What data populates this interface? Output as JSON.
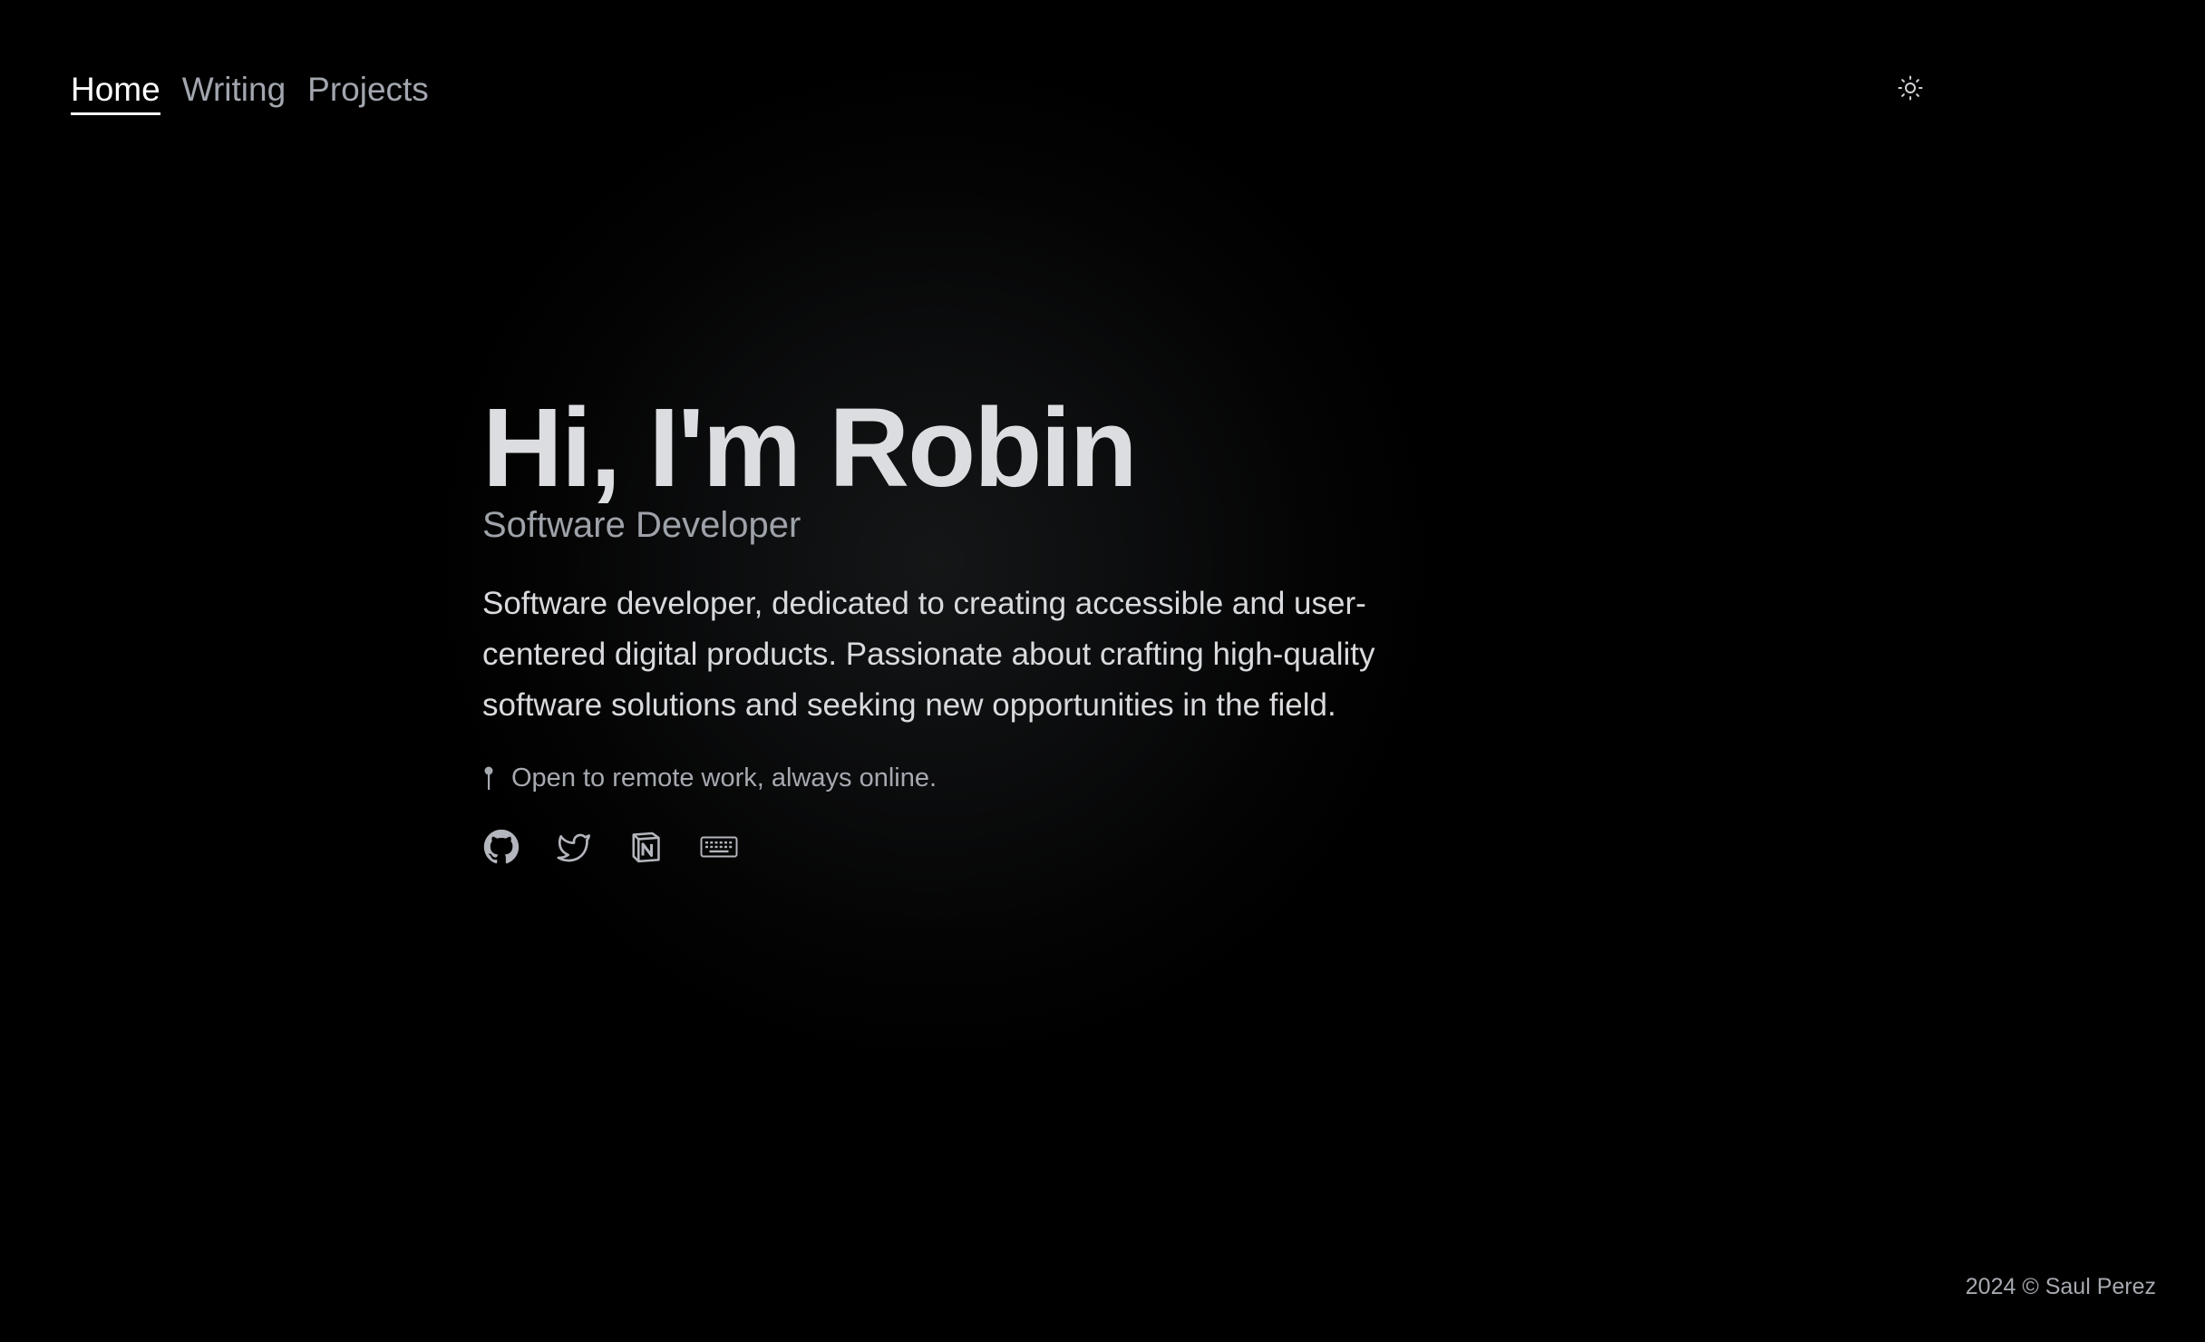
{
  "nav": {
    "items": [
      {
        "label": "Home",
        "active": true
      },
      {
        "label": "Writing",
        "active": false
      },
      {
        "label": "Projects",
        "active": false
      }
    ]
  },
  "theme_toggle": {
    "icon": "sun-icon"
  },
  "hero": {
    "title": "Hi, I'm Robin",
    "role": "Software Developer",
    "bio": "Software developer, dedicated to creating accessible and user-centered digital products. Passionate about crafting high-quality software solutions and seeking new opportunities in the field.",
    "location": "Open to remote work, always online.",
    "location_icon": "pin-icon"
  },
  "socials": [
    {
      "name": "github",
      "icon": "github-icon"
    },
    {
      "name": "twitter",
      "icon": "twitter-icon"
    },
    {
      "name": "notion",
      "icon": "notion-icon"
    },
    {
      "name": "keyboard",
      "icon": "keyboard-icon"
    }
  ],
  "footer": {
    "text": "2024 © Saul Perez"
  },
  "colors": {
    "background": "#000000",
    "text_primary": "#dcdde0",
    "text_secondary": "#a2a6ae",
    "nav_active": "#ffffff"
  }
}
